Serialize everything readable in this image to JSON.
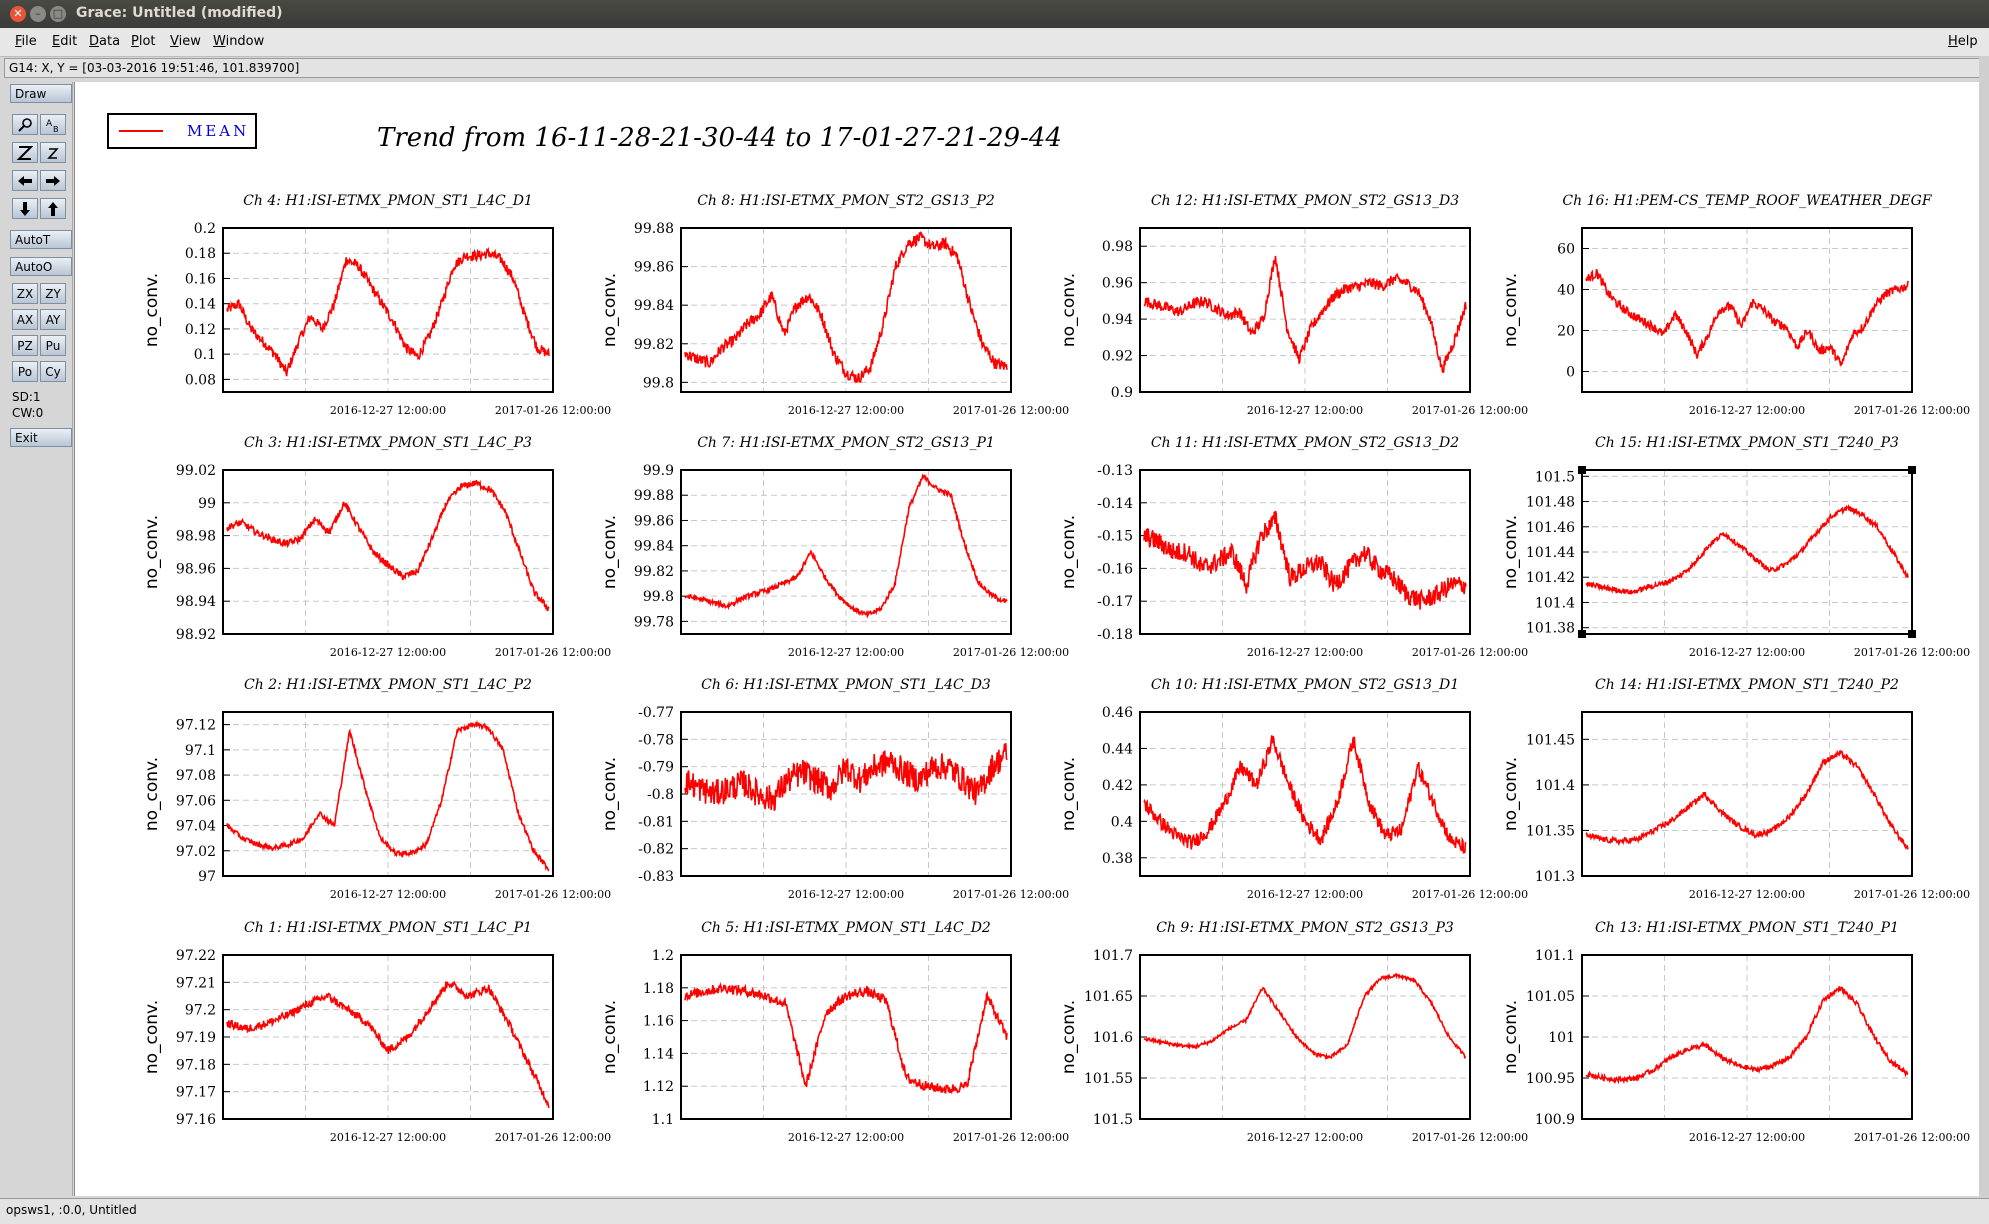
{
  "window": {
    "title": "Grace: Untitled (modified)"
  },
  "menubar": {
    "items": [
      "File",
      "Edit",
      "Data",
      "Plot",
      "View",
      "Window"
    ],
    "help": "Help"
  },
  "location": "G14: X, Y = [03-03-2016 19:51:46, 101.839700]",
  "tools": {
    "draw": "Draw",
    "autot": "AutoT",
    "autoo": "AutoO",
    "small": [
      "ZX",
      "ZY",
      "AX",
      "AY",
      "PZ",
      "Pu",
      "Po",
      "Cy"
    ],
    "sd": "SD:1",
    "cw": "CW:0",
    "exit": "Exit"
  },
  "statusbar": "opsws1, :0.0, Untitled",
  "plot": {
    "title": "Trend from 16-11-28-21-30-44 to 17-01-27-21-29-44",
    "legend": "MEAN",
    "line_color": "#ff0000",
    "ylabel": "no_conv.",
    "xtick_labels": [
      "2016-12-27 12:00:00",
      "2017-01-26 12:00:00"
    ],
    "selected_graph": "Ch 15"
  },
  "chart_data": [
    {
      "type": "line",
      "title": "Ch 4: H1:ISI-ETMX_PMON_ST1_L4C_D1",
      "ylabel": "no_conv.",
      "ylim": [
        0.07,
        0.2
      ],
      "yticks": [
        "0.2",
        "0.18",
        "0.16",
        "0.14",
        "0.12",
        "0.1",
        "0.08"
      ],
      "ytickvals": [
        0.2,
        0.18,
        0.16,
        0.14,
        0.12,
        0.1,
        0.08
      ],
      "noise": 0.004,
      "series": [
        {
          "name": "MEAN",
          "values": [
            0.135,
            0.14,
            0.12,
            0.11,
            0.1,
            0.085,
            0.11,
            0.13,
            0.12,
            0.14,
            0.175,
            0.17,
            0.155,
            0.14,
            0.125,
            0.105,
            0.098,
            0.115,
            0.14,
            0.17,
            0.178,
            0.178,
            0.18,
            0.175,
            0.16,
            0.13,
            0.105,
            0.1
          ]
        }
      ]
    },
    {
      "type": "line",
      "title": "Ch 8: H1:ISI-ETMX_PMON_ST2_GS13_P2",
      "ylabel": "no_conv.",
      "ylim": [
        99.795,
        99.88
      ],
      "yticks": [
        "99.88",
        "99.86",
        "99.84",
        "99.82",
        "99.8"
      ],
      "ytickvals": [
        99.88,
        99.86,
        99.84,
        99.82,
        99.8
      ],
      "noise": 0.003,
      "series": [
        {
          "name": "MEAN",
          "values": [
            99.815,
            99.812,
            99.81,
            99.818,
            99.822,
            99.83,
            99.835,
            99.845,
            99.825,
            99.84,
            99.845,
            99.835,
            99.815,
            99.805,
            99.802,
            99.808,
            99.83,
            99.86,
            99.872,
            99.875,
            99.87,
            99.872,
            99.865,
            99.84,
            99.82,
            99.81,
            99.808
          ]
        }
      ]
    },
    {
      "type": "line",
      "title": "Ch 12: H1:ISI-ETMX_PMON_ST2_GS13_D3",
      "ylabel": "no_conv.",
      "ylim": [
        0.9,
        0.99
      ],
      "yticks": [
        "0.98",
        "0.96",
        "0.94",
        "0.92",
        "0.9"
      ],
      "ytickvals": [
        0.98,
        0.96,
        0.94,
        0.92,
        0.9
      ],
      "noise": 0.003,
      "series": [
        {
          "name": "MEAN",
          "values": [
            0.95,
            0.948,
            0.946,
            0.944,
            0.948,
            0.95,
            0.946,
            0.942,
            0.944,
            0.932,
            0.94,
            0.975,
            0.935,
            0.918,
            0.935,
            0.945,
            0.953,
            0.957,
            0.958,
            0.96,
            0.958,
            0.962,
            0.96,
            0.955,
            0.94,
            0.912,
            0.928,
            0.948
          ]
        }
      ]
    },
    {
      "type": "line",
      "title": "Ch 16: H1:PEM-CS_TEMP_ROOF_WEATHER_DEGF",
      "ylabel": "no_conv.",
      "ylim": [
        -10,
        70
      ],
      "yticks": [
        "60",
        "40",
        "20",
        "0"
      ],
      "ytickvals": [
        60,
        40,
        20,
        0
      ],
      "noise": 2.2,
      "series": [
        {
          "name": "MEAN",
          "values": [
            45,
            48,
            38,
            32,
            28,
            25,
            22,
            18,
            28,
            20,
            8,
            18,
            30,
            32,
            22,
            34,
            30,
            24,
            22,
            12,
            20,
            10,
            12,
            3,
            18,
            22,
            32,
            38,
            40,
            42
          ]
        }
      ]
    },
    {
      "type": "line",
      "title": "Ch 3: H1:ISI-ETMX_PMON_ST1_L4C_P3",
      "ylabel": "no_conv.",
      "ylim": [
        98.92,
        99.02
      ],
      "yticks": [
        "99.02",
        "99",
        "98.98",
        "98.96",
        "98.94",
        "98.92"
      ],
      "ytickvals": [
        99.02,
        99,
        98.98,
        98.96,
        98.94,
        98.92
      ],
      "noise": 0.002,
      "series": [
        {
          "name": "MEAN",
          "values": [
            98.985,
            98.988,
            98.982,
            98.978,
            98.975,
            98.978,
            98.99,
            98.982,
            99.0,
            98.985,
            98.97,
            98.962,
            98.955,
            98.958,
            98.978,
            99.0,
            99.01,
            99.012,
            99.008,
            98.995,
            98.97,
            98.945,
            98.935
          ]
        }
      ]
    },
    {
      "type": "line",
      "title": "Ch 7: H1:ISI-ETMX_PMON_ST2_GS13_P1",
      "ylabel": "no_conv.",
      "ylim": [
        99.77,
        99.9
      ],
      "yticks": [
        "99.9",
        "99.88",
        "99.86",
        "99.84",
        "99.82",
        "99.8",
        "99.78"
      ],
      "ytickvals": [
        99.9,
        99.88,
        99.86,
        99.84,
        99.82,
        99.8,
        99.78
      ],
      "noise": 0.002,
      "series": [
        {
          "name": "MEAN",
          "values": [
            99.8,
            99.798,
            99.795,
            99.792,
            99.798,
            99.802,
            99.805,
            99.81,
            99.815,
            99.835,
            99.815,
            99.8,
            99.79,
            99.785,
            99.79,
            99.81,
            99.87,
            99.895,
            99.885,
            99.88,
            99.84,
            99.81,
            99.8,
            99.795
          ]
        }
      ]
    },
    {
      "type": "line",
      "title": "Ch 11: H1:ISI-ETMX_PMON_ST2_GS13_D2",
      "ylabel": "no_conv.",
      "ylim": [
        -0.18,
        -0.13
      ],
      "yticks": [
        "-0.13",
        "-0.14",
        "-0.15",
        "-0.16",
        "-0.17",
        "-0.18"
      ],
      "ytickvals": [
        -0.13,
        -0.14,
        -0.15,
        -0.16,
        -0.17,
        -0.18
      ],
      "noise": 0.003,
      "series": [
        {
          "name": "MEAN",
          "values": [
            -0.15,
            -0.152,
            -0.155,
            -0.155,
            -0.16,
            -0.158,
            -0.155,
            -0.165,
            -0.15,
            -0.145,
            -0.163,
            -0.16,
            -0.158,
            -0.165,
            -0.16,
            -0.155,
            -0.16,
            -0.163,
            -0.168,
            -0.17,
            -0.168,
            -0.165,
            -0.165
          ]
        }
      ]
    },
    {
      "type": "line",
      "title": "Ch 15: H1:ISI-ETMX_PMON_ST1_T240_P3",
      "ylabel": "no_conv.",
      "ylim": [
        101.375,
        101.505
      ],
      "yticks": [
        "101.5",
        "101.48",
        "101.46",
        "101.44",
        "101.42",
        "101.4",
        "101.38"
      ],
      "ytickvals": [
        101.5,
        101.48,
        101.46,
        101.44,
        101.42,
        101.4,
        101.38
      ],
      "noise": 0.002,
      "series": [
        {
          "name": "MEAN",
          "values": [
            101.415,
            101.412,
            101.41,
            101.408,
            101.412,
            101.415,
            101.42,
            101.43,
            101.445,
            101.455,
            101.445,
            101.435,
            101.425,
            101.43,
            101.44,
            101.455,
            101.468,
            101.475,
            101.47,
            101.46,
            101.44,
            101.42
          ]
        }
      ]
    },
    {
      "type": "line",
      "title": "Ch 2: H1:ISI-ETMX_PMON_ST1_L4C_P2",
      "ylabel": "no_conv.",
      "ylim": [
        97.0,
        97.13
      ],
      "yticks": [
        "97.12",
        "97.1",
        "97.08",
        "97.06",
        "97.04",
        "97.02",
        "97"
      ],
      "ytickvals": [
        97.12,
        97.1,
        97.08,
        97.06,
        97.04,
        97.02,
        97.0
      ],
      "noise": 0.002,
      "series": [
        {
          "name": "MEAN",
          "values": [
            97.04,
            97.03,
            97.025,
            97.022,
            97.025,
            97.03,
            97.05,
            97.04,
            97.115,
            97.07,
            97.03,
            97.018,
            97.018,
            97.025,
            97.06,
            97.115,
            97.12,
            97.118,
            97.1,
            97.05,
            97.02,
            97.005
          ]
        }
      ]
    },
    {
      "type": "line",
      "title": "Ch 6: H1:ISI-ETMX_PMON_ST1_L4C_D3",
      "ylabel": "no_conv.",
      "ylim": [
        -0.83,
        -0.77
      ],
      "yticks": [
        "-0.77",
        "-0.78",
        "-0.79",
        "-0.8",
        "-0.81",
        "-0.82",
        "-0.83"
      ],
      "ytickvals": [
        -0.77,
        -0.78,
        -0.79,
        -0.8,
        -0.81,
        -0.82,
        -0.83
      ],
      "noise": 0.005,
      "series": [
        {
          "name": "MEAN",
          "values": [
            -0.795,
            -0.798,
            -0.8,
            -0.798,
            -0.796,
            -0.8,
            -0.802,
            -0.795,
            -0.792,
            -0.795,
            -0.798,
            -0.79,
            -0.795,
            -0.79,
            -0.788,
            -0.792,
            -0.795,
            -0.79,
            -0.79,
            -0.795,
            -0.8,
            -0.79,
            -0.785
          ]
        }
      ]
    },
    {
      "type": "line",
      "title": "Ch 10: H1:ISI-ETMX_PMON_ST2_GS13_D1",
      "ylabel": "no_conv.",
      "ylim": [
        0.37,
        0.46
      ],
      "yticks": [
        "0.46",
        "0.44",
        "0.42",
        "0.4",
        "0.38"
      ],
      "ytickvals": [
        0.46,
        0.44,
        0.42,
        0.4,
        0.38
      ],
      "noise": 0.004,
      "series": [
        {
          "name": "MEAN",
          "values": [
            0.41,
            0.4,
            0.392,
            0.388,
            0.395,
            0.41,
            0.43,
            0.42,
            0.445,
            0.42,
            0.4,
            0.39,
            0.41,
            0.445,
            0.41,
            0.392,
            0.395,
            0.43,
            0.41,
            0.39,
            0.385
          ]
        }
      ]
    },
    {
      "type": "line",
      "title": "Ch 14: H1:ISI-ETMX_PMON_ST1_T240_P2",
      "ylabel": "no_conv.",
      "ylim": [
        101.3,
        101.48
      ],
      "yticks": [
        "101.45",
        "101.4",
        "101.35",
        "101.3"
      ],
      "ytickvals": [
        101.45,
        101.4,
        101.35,
        101.3
      ],
      "noise": 0.003,
      "series": [
        {
          "name": "MEAN",
          "values": [
            101.345,
            101.34,
            101.338,
            101.34,
            101.35,
            101.36,
            101.375,
            101.39,
            101.37,
            101.355,
            101.345,
            101.35,
            101.365,
            101.39,
            101.425,
            101.435,
            101.42,
            101.39,
            101.355,
            101.33
          ]
        }
      ]
    },
    {
      "type": "line",
      "title": "Ch 1: H1:ISI-ETMX_PMON_ST1_L4C_P1",
      "ylabel": "no_conv.",
      "ylim": [
        97.16,
        97.22
      ],
      "yticks": [
        "97.22",
        "97.21",
        "97.2",
        "97.19",
        "97.18",
        "97.17",
        "97.16"
      ],
      "ytickvals": [
        97.22,
        97.21,
        97.2,
        97.19,
        97.18,
        97.17,
        97.16
      ],
      "noise": 0.0015,
      "series": [
        {
          "name": "MEAN",
          "values": [
            97.195,
            97.193,
            97.195,
            97.198,
            97.202,
            97.205,
            97.2,
            97.195,
            97.185,
            97.19,
            97.2,
            97.21,
            97.205,
            97.208,
            97.195,
            97.18,
            97.165
          ]
        }
      ]
    },
    {
      "type": "line",
      "title": "Ch 5: H1:ISI-ETMX_PMON_ST1_L4C_D2",
      "ylabel": "no_conv.",
      "ylim": [
        1.1,
        1.2
      ],
      "yticks": [
        "1.2",
        "1.18",
        "1.16",
        "1.14",
        "1.12",
        "1.1"
      ],
      "ytickvals": [
        1.2,
        1.18,
        1.16,
        1.14,
        1.12,
        1.1
      ],
      "noise": 0.003,
      "series": [
        {
          "name": "MEAN",
          "values": [
            1.175,
            1.178,
            1.18,
            1.178,
            1.175,
            1.17,
            1.12,
            1.165,
            1.175,
            1.178,
            1.172,
            1.125,
            1.12,
            1.118,
            1.12,
            1.175,
            1.15
          ]
        }
      ]
    },
    {
      "type": "line",
      "title": "Ch 9: H1:ISI-ETMX_PMON_ST2_GS13_P3",
      "ylabel": "no_conv.",
      "ylim": [
        101.5,
        101.7
      ],
      "yticks": [
        "101.7",
        "101.65",
        "101.6",
        "101.55",
        "101.5"
      ],
      "ytickvals": [
        101.7,
        101.65,
        101.6,
        101.55,
        101.5
      ],
      "noise": 0.002,
      "series": [
        {
          "name": "MEAN",
          "values": [
            101.598,
            101.594,
            101.59,
            101.588,
            101.595,
            101.61,
            101.62,
            101.66,
            101.63,
            101.6,
            101.58,
            101.575,
            101.59,
            101.65,
            101.672,
            101.675,
            101.668,
            101.64,
            101.6,
            101.575
          ]
        }
      ]
    },
    {
      "type": "line",
      "title": "Ch 13: H1:ISI-ETMX_PMON_ST1_T240_P1",
      "ylabel": "no_conv.",
      "ylim": [
        100.9,
        101.1
      ],
      "yticks": [
        "101.1",
        "101.05",
        "101",
        "100.95",
        "100.9"
      ],
      "ytickvals": [
        101.1,
        101.05,
        101.0,
        100.95,
        100.9
      ],
      "noise": 0.003,
      "series": [
        {
          "name": "MEAN",
          "values": [
            100.955,
            100.95,
            100.948,
            100.95,
            100.96,
            100.975,
            100.985,
            100.99,
            100.975,
            100.965,
            100.96,
            100.965,
            100.975,
            101.0,
            101.045,
            101.06,
            101.04,
            101.0,
            100.97,
            100.955
          ]
        }
      ]
    }
  ]
}
